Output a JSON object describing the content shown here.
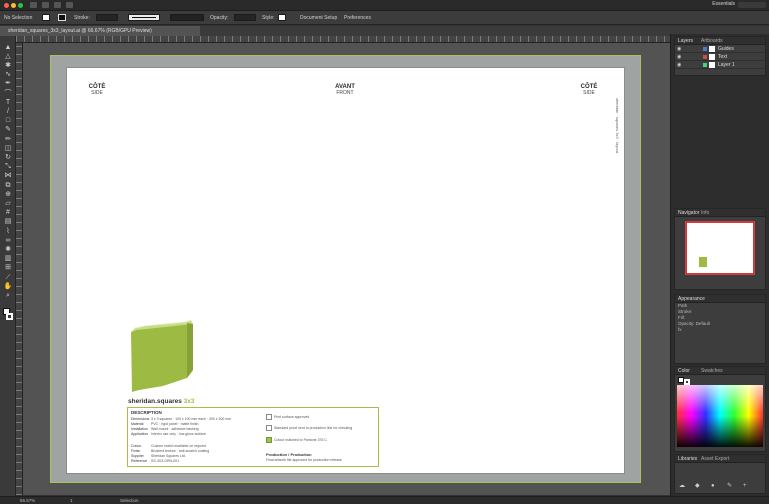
{
  "app": {
    "workspace_label": "Essentials",
    "accent_color": "#a3c14a"
  },
  "control_bar": {
    "selection_label": "No Selection",
    "stroke_label": "Stroke:",
    "style_label": "Style:",
    "opacity_label": "Opacity:",
    "opacity_value": "100%",
    "doc_setup_label": "Document Setup",
    "preferences_label": "Preferences"
  },
  "document_tab": {
    "title": "sheridan_squares_3x3_layout.ai @ 66.67% (RGB/GPU Preview)"
  },
  "tools": [
    {
      "name": "selection-tool",
      "glyph": "▲"
    },
    {
      "name": "direct-selection-tool",
      "glyph": "△"
    },
    {
      "name": "magic-wand-tool",
      "glyph": "✱"
    },
    {
      "name": "lasso-tool",
      "glyph": "∿"
    },
    {
      "name": "pen-tool",
      "glyph": "✒"
    },
    {
      "name": "curvature-tool",
      "glyph": "⌒"
    },
    {
      "name": "type-tool",
      "glyph": "T"
    },
    {
      "name": "line-tool",
      "glyph": "/"
    },
    {
      "name": "rectangle-tool",
      "glyph": "□"
    },
    {
      "name": "paintbrush-tool",
      "glyph": "✎"
    },
    {
      "name": "pencil-tool",
      "glyph": "✏"
    },
    {
      "name": "eraser-tool",
      "glyph": "◫"
    },
    {
      "name": "rotate-tool",
      "glyph": "↻"
    },
    {
      "name": "scale-tool",
      "glyph": "⤡"
    },
    {
      "name": "width-tool",
      "glyph": "⋈"
    },
    {
      "name": "free-transform-tool",
      "glyph": "⧉"
    },
    {
      "name": "shape-builder-tool",
      "glyph": "⊕"
    },
    {
      "name": "perspective-grid-tool",
      "glyph": "▱"
    },
    {
      "name": "mesh-tool",
      "glyph": "#"
    },
    {
      "name": "gradient-tool",
      "glyph": "▤"
    },
    {
      "name": "eyedropper-tool",
      "glyph": "⌇"
    },
    {
      "name": "blend-tool",
      "glyph": "∞"
    },
    {
      "name": "symbol-sprayer-tool",
      "glyph": "✺"
    },
    {
      "name": "graph-tool",
      "glyph": "▥"
    },
    {
      "name": "artboard-tool",
      "glyph": "⊞"
    },
    {
      "name": "slice-tool",
      "glyph": "⟋"
    },
    {
      "name": "hand-tool",
      "glyph": "✋"
    },
    {
      "name": "zoom-tool",
      "glyph": "⌕"
    }
  ],
  "artboard": {
    "left_label_title": "CÔTÉ",
    "left_label_sub": "SIDE",
    "center_label_title": "AVANT",
    "center_label_sub": "FRONT",
    "right_label_title": "CÔTÉ",
    "right_label_sub": "SIDE",
    "vertical_text": "sheridan · squares 3x3 · layout",
    "brand_name": "sheridan.squares",
    "brand_accent": "3x3",
    "spec_heading": "DESCRIPTION",
    "spec_rows": [
      {
        "k": "Dimensions",
        "v": "3 x 3 squares · 100 x 100 mm each · 300 x 300 mm"
      },
      {
        "k": "Material",
        "v": "PVC · rigid panel · matte finish"
      },
      {
        "k": "Installation",
        "v": "Wall mount · adhesive backing"
      },
      {
        "k": "Application",
        "v": "Interior use only · low-gloss surface"
      },
      {
        "k": "Colour",
        "v": "Custom match available on request"
      },
      {
        "k": "Finish",
        "v": "Brushed texture · anti-scratch coating"
      },
      {
        "k": "Supplier",
        "v": "Sheridan Squares Ltd."
      },
      {
        "k": "Reference",
        "v": "SS-3X3-GRN-001"
      }
    ],
    "checks": [
      {
        "text": "Print surface approved",
        "on": false
      },
      {
        "text": "Standard proof sent to production line for checking",
        "on": false
      },
      {
        "text": "Colour matched to Pantone 376 C",
        "on": true
      }
    ],
    "footer_title": "Production / Production",
    "footer_text": "Final artwork file approved for production release"
  },
  "panels": {
    "layers": {
      "title": "Layers",
      "tab2": "Artboards",
      "rows": [
        {
          "name": "Guides",
          "color": "#4a7bd1"
        },
        {
          "name": "Text",
          "color": "#d14a4a"
        },
        {
          "name": "Layer 1",
          "color": "#4ad17b"
        }
      ]
    },
    "navigator": {
      "title": "Navigator",
      "tab2": "Info"
    },
    "properties": {
      "title": "Appearance",
      "lines": [
        "Path",
        "Stroke:",
        "Fill:",
        "Opacity: Default",
        "fx"
      ]
    },
    "color": {
      "title": "Color",
      "tab2": "Swatches"
    },
    "libraries": {
      "title": "Libraries",
      "tab2": "Asset Export"
    }
  },
  "status_bar": {
    "zoom": "66.67%",
    "artboard_nav": "1",
    "tool_name": "Selection"
  }
}
